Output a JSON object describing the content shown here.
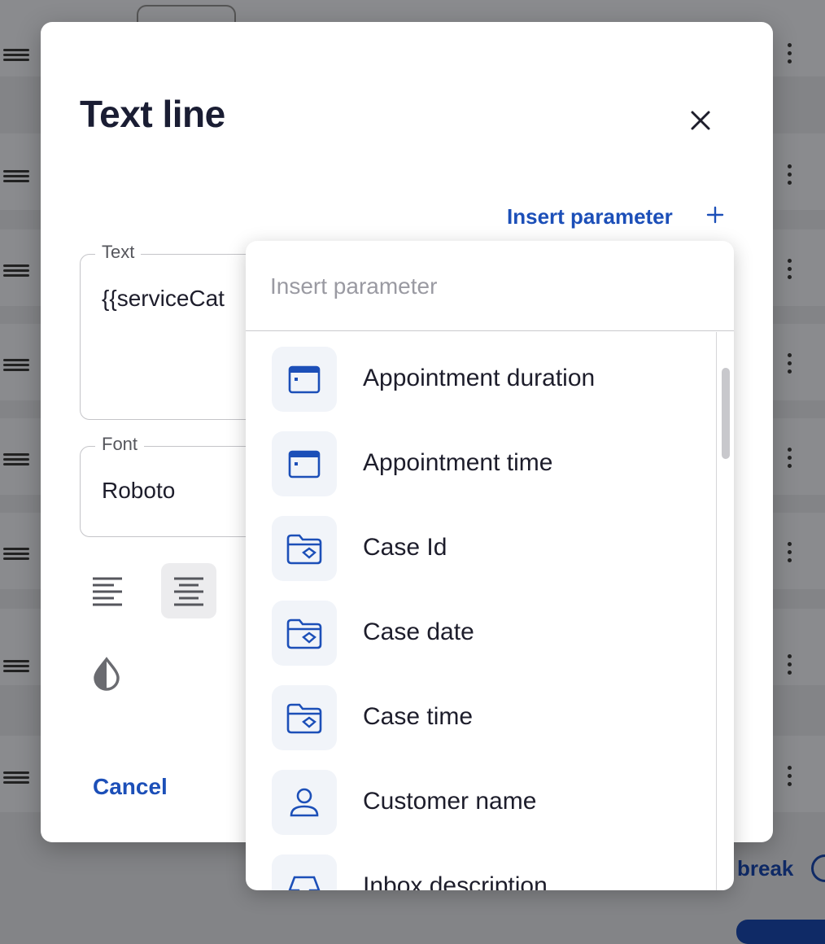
{
  "dialog": {
    "title": "Text line",
    "insert_parameter_label": "Insert parameter",
    "text_field": {
      "label": "Text",
      "value": "{{serviceCat"
    },
    "font_field": {
      "label": "Font",
      "value": "Roboto"
    },
    "cancel_label": "Cancel"
  },
  "popover": {
    "search_placeholder": "Insert parameter",
    "items": [
      {
        "label": "Appointment duration",
        "icon": "calendar-icon"
      },
      {
        "label": "Appointment time",
        "icon": "calendar-icon"
      },
      {
        "label": "Case Id",
        "icon": "folder-icon"
      },
      {
        "label": "Case date",
        "icon": "folder-icon"
      },
      {
        "label": "Case time",
        "icon": "folder-icon"
      },
      {
        "label": "Customer name",
        "icon": "person-icon"
      },
      {
        "label": "Inbox description",
        "icon": "inbox-icon"
      }
    ]
  },
  "background": {
    "break_label": "break"
  },
  "colors": {
    "accent": "#1c4fb8",
    "icon_bg": "#f1f4f9",
    "overlay": "#838487"
  }
}
